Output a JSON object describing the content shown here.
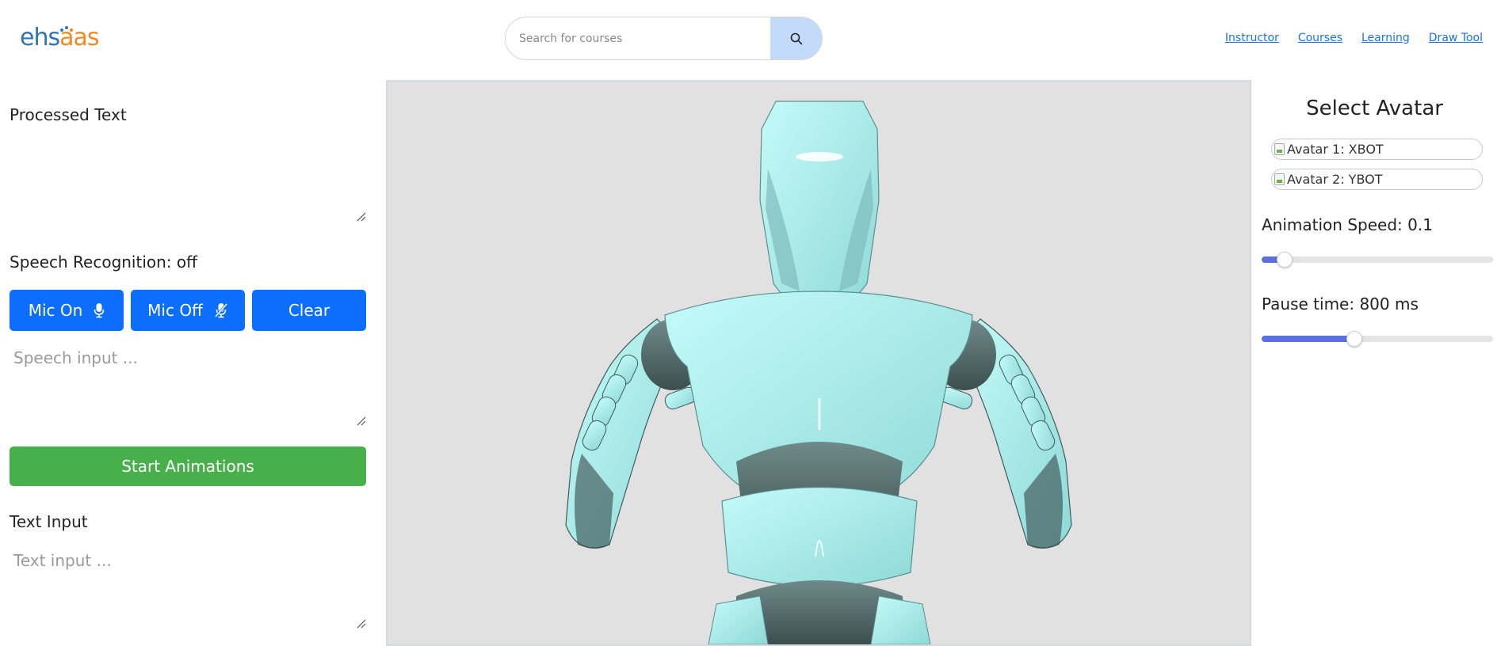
{
  "header": {
    "logo": {
      "part1": "eh",
      "part2": "s",
      "part3": "aas"
    },
    "search": {
      "placeholder": "Search for courses",
      "value": ""
    },
    "nav": [
      "Instructor",
      "Courses",
      "Learning",
      "Draw Tool"
    ]
  },
  "left_panel": {
    "processed_text_label": "Processed Text",
    "processed_text_value": "",
    "speech_status": "Speech Recognition: off",
    "buttons": {
      "mic_on": "Mic On",
      "mic_off": "Mic Off",
      "clear": "Clear"
    },
    "speech_placeholder": "Speech input ...",
    "start_button": "Start Animations",
    "text_input_label": "Text Input",
    "text_placeholder": "Text input ..."
  },
  "right_panel": {
    "title": "Select Avatar",
    "avatars": [
      "Avatar 1: XBOT",
      "Avatar 2: YBOT"
    ],
    "animation_speed_label": "Animation Speed: 0.1",
    "animation_speed_fraction": 0.1,
    "pause_time_label": "Pause time: 800 ms",
    "pause_time_fraction": 0.4
  },
  "colors": {
    "primary": "#0d6efd",
    "success": "#47b04b",
    "link": "#1a73e8",
    "slider_fill": "#5a6fe0",
    "avatar_body": "#a6f0ee",
    "viewport_bg": "#e1e1e1"
  }
}
